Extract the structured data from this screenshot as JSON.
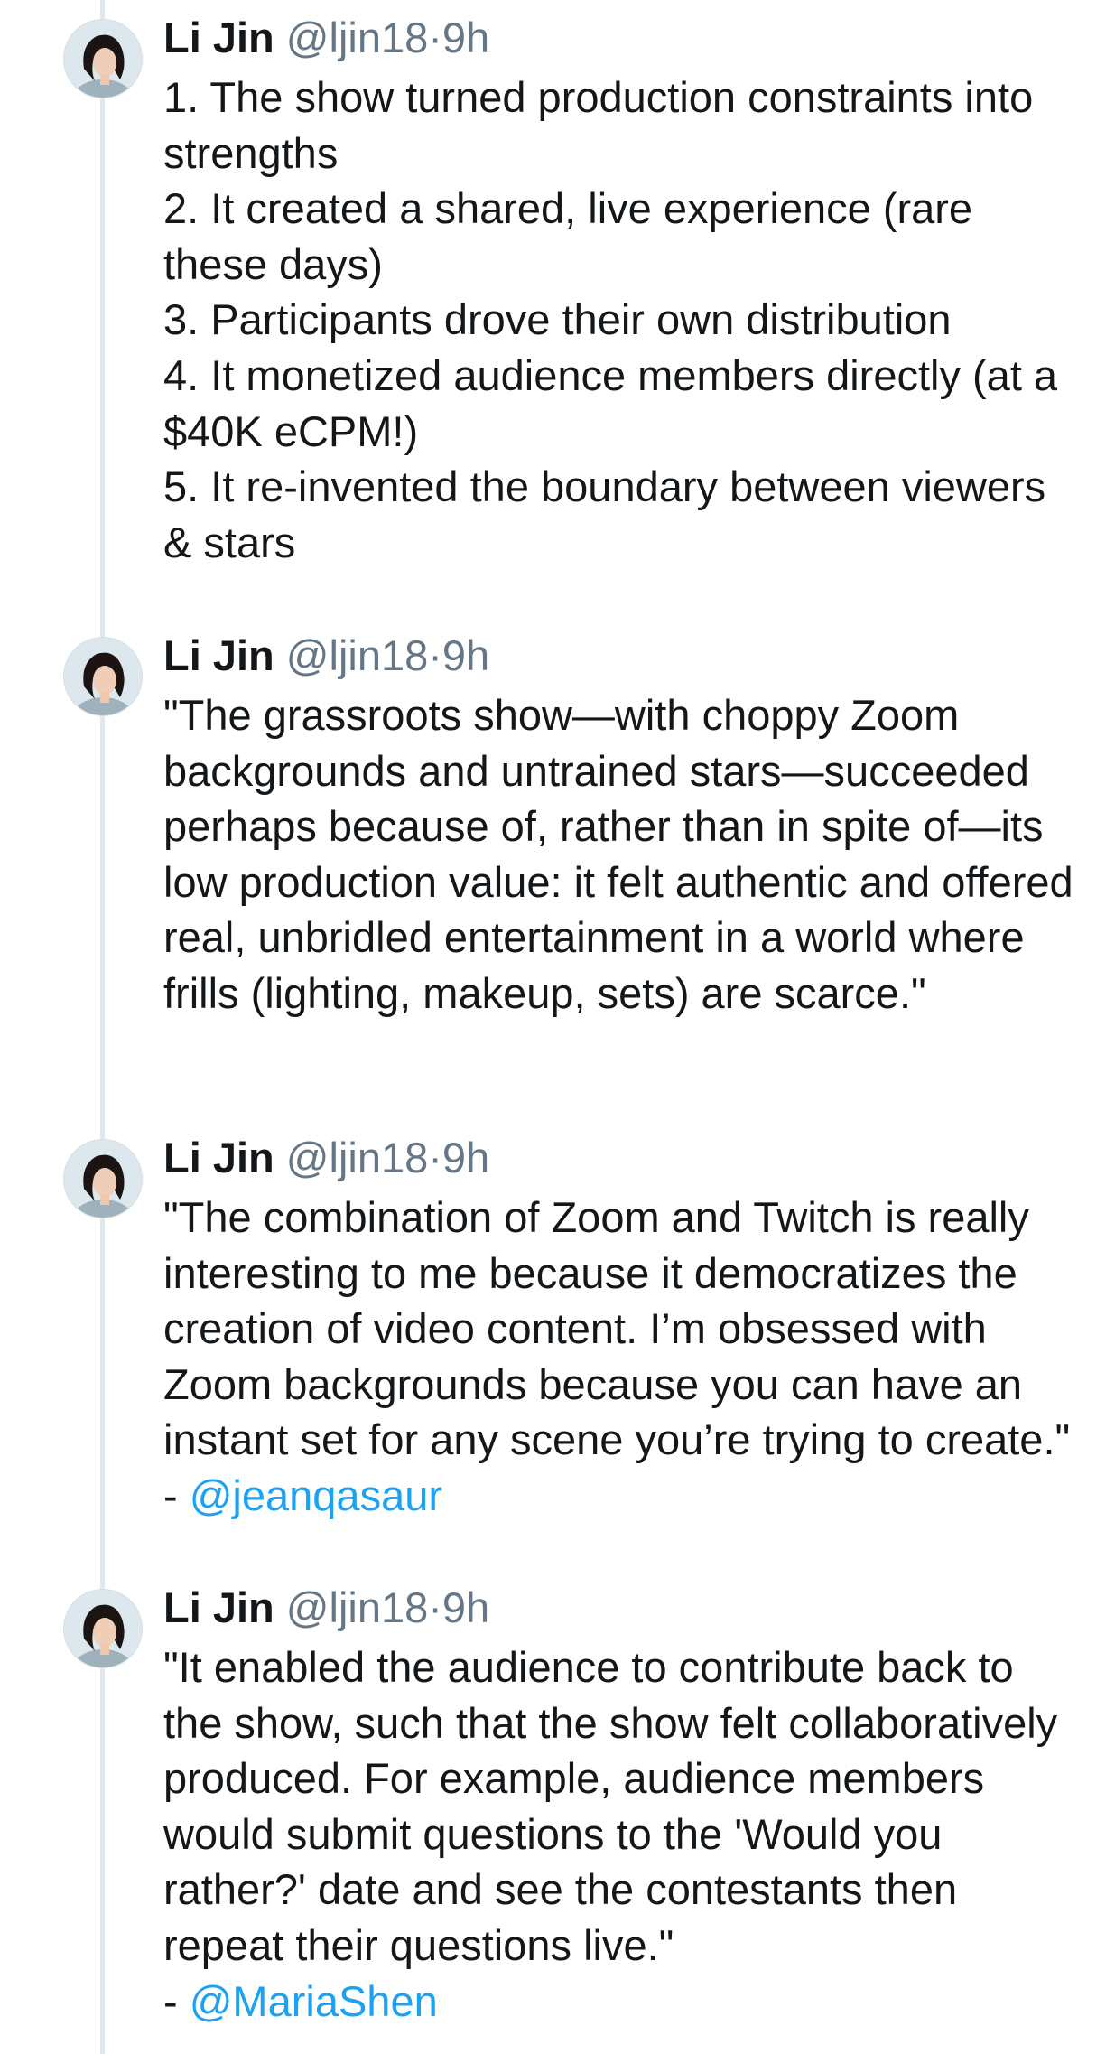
{
  "tweets": [
    {
      "author": {
        "name": "Li Jin",
        "handle": "@ljin18",
        "time": "9h",
        "avatar_icon": "profile-photo"
      },
      "text": "1. The show turned production constraints into strengths\n2. It created a shared, live experience (rare these days)\n3. Participants drove their own distribution\n4. It monetized audience members directly (at a $40K eCPM!)\n5. It re-invented the boundary between viewers & stars",
      "mention": ""
    },
    {
      "author": {
        "name": "Li Jin",
        "handle": "@ljin18",
        "time": "9h",
        "avatar_icon": "profile-photo"
      },
      "text": "\"The grassroots show—with choppy Zoom backgrounds and untrained stars—succeeded perhaps because of, rather than in spite of—its low production value: it felt authentic and offered real, unbridled entertainment in a world where frills (lighting, makeup, sets) are scarce.\"",
      "mention": ""
    },
    {
      "author": {
        "name": "Li Jin",
        "handle": "@ljin18",
        "time": "9h",
        "avatar_icon": "profile-photo"
      },
      "text": "\"The combination of Zoom and Twitch is really interesting to me because it democratizes the creation of video content. I’m obsessed with Zoom backgrounds because you can have an instant set for any scene you’re trying to create.\" - ",
      "mention": "@jeanqasaur"
    },
    {
      "author": {
        "name": "Li Jin",
        "handle": "@ljin18",
        "time": "9h",
        "avatar_icon": "profile-photo"
      },
      "text": "\"It enabled the audience to contribute back to the show, such that the show felt collaboratively produced. For example, audience members would submit questions to the 'Would you rather?' date and see the contestants then repeat their questions live.\"\n- ",
      "mention": "@MariaShen"
    }
  ],
  "separator": "·",
  "colors": {
    "text": "#14171a",
    "secondary": "#657786",
    "link": "#1da1f2",
    "thread_line": "#e1e8ed"
  }
}
